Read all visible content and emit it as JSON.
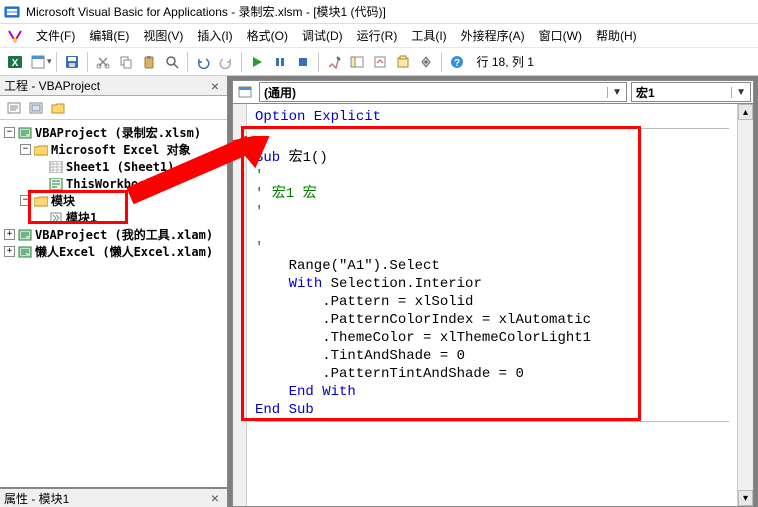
{
  "title": "Microsoft Visual Basic for Applications - 录制宏.xlsm - [模块1 (代码)]",
  "menu": {
    "file": "文件(F)",
    "edit": "编辑(E)",
    "view": "视图(V)",
    "insert": "插入(I)",
    "format": "格式(O)",
    "debug": "调试(D)",
    "run": "运行(R)",
    "tools": "工具(I)",
    "addins": "外接程序(A)",
    "window": "窗口(W)",
    "help": "帮助(H)"
  },
  "toolbar": {
    "position": "行 18, 列 1"
  },
  "project_pane": {
    "title": "工程 - VBAProject",
    "tree": {
      "proj1": "VBAProject (录制宏.xlsm)",
      "excel_objects": "Microsoft Excel 对象",
      "sheet1": "Sheet1 (Sheet1)",
      "thiswb": "ThisWorkbook",
      "modules": "模块",
      "module1": "模块1",
      "proj2": "VBAProject (我的工具.xlam)",
      "proj3": "懒人Excel (懒人Excel.xlam)"
    }
  },
  "props_pane": {
    "title": "属性 - 模块1"
  },
  "code": {
    "dd_left": "(通用)",
    "dd_right": "宏1",
    "line_option": "Option Explicit",
    "sub_kw": "Sub",
    "sub_name": " 宏1()",
    "cm_tick1": "'",
    "cm_name": "' 宏1 宏",
    "cm_tick2": "'",
    "cm_tick3": "'",
    "l_range": "    Range(\"A1\").Select",
    "with_kw": "With",
    "l_with_rest": " Selection.Interior",
    "l_pattern": "        .Pattern = xlSolid",
    "l_pci": "        .PatternColorIndex = xlAutomatic",
    "l_theme": "        .ThemeColor = xlThemeColorLight1",
    "l_tas": "        .TintAndShade = 0",
    "l_ptas": "        .PatternTintAndShade = 0",
    "end_with": "End With",
    "end_sub": "End Sub"
  }
}
